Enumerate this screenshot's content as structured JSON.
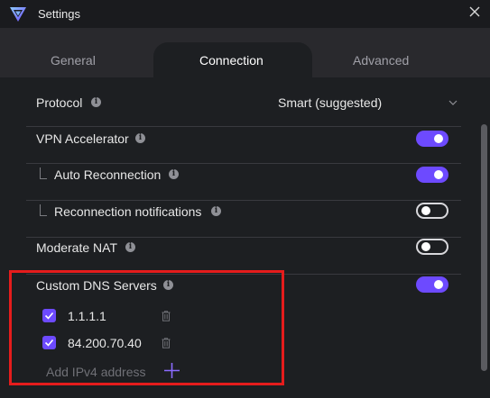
{
  "window": {
    "title": "Settings",
    "logo_icon": "proton-vpn-logo",
    "close_icon": "close-icon"
  },
  "tabs": [
    {
      "label": "General",
      "active": false
    },
    {
      "label": "Connection",
      "active": true
    },
    {
      "label": "Advanced",
      "active": false
    }
  ],
  "settings": {
    "protocol": {
      "label": "Protocol",
      "value": "Smart (suggested)"
    },
    "vpn_accelerator": {
      "label": "VPN Accelerator",
      "enabled": true
    },
    "auto_reconnection": {
      "label": "Auto Reconnection",
      "enabled": true
    },
    "reconnection_notifications": {
      "label": "Reconnection notifications",
      "enabled": false
    },
    "moderate_nat": {
      "label": "Moderate NAT",
      "enabled": false
    },
    "custom_dns": {
      "label": "Custom DNS Servers",
      "enabled": true,
      "servers": [
        {
          "address": "1.1.1.1",
          "checked": true
        },
        {
          "address": "84.200.70.40",
          "checked": true
        }
      ],
      "add_placeholder": "Add IPv4 address"
    }
  },
  "colors": {
    "accent": "#6d4aff",
    "background": "#1d1f22",
    "tabbar": "#29292d",
    "highlight": "#e51c1c"
  }
}
